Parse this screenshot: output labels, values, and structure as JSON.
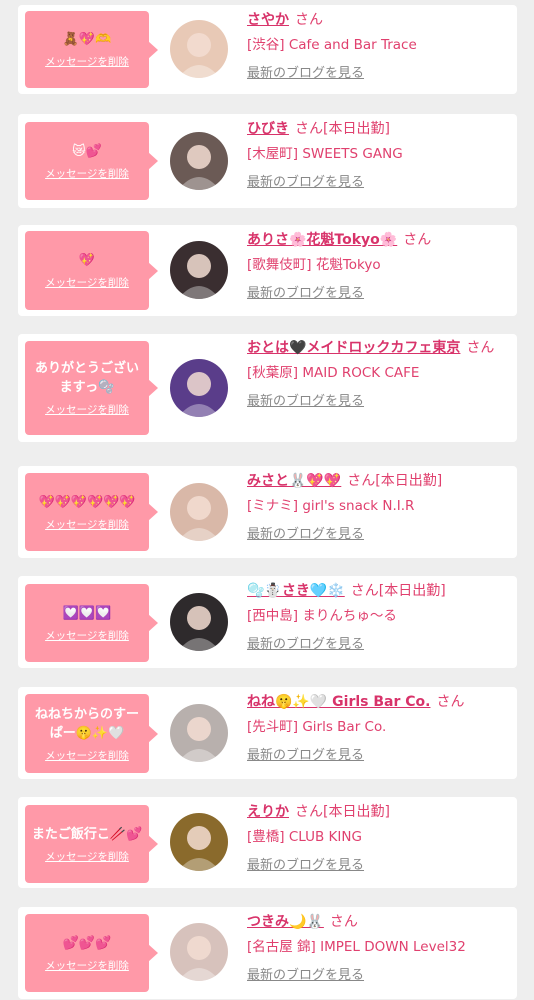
{
  "delete_label": "メッセージを削除",
  "blog_label": "最新のブログを見る",
  "cards": [
    {
      "message": "🧸💖🫶",
      "name": "さやか",
      "suffix": "さん",
      "shop": "[渋谷] Cafe and Bar Trace",
      "avatar_color": "#e8c9b6"
    },
    {
      "message": "😿💕",
      "name": "ひびき",
      "suffix": "さん[本日出勤]",
      "shop": "[木屋町] SWEETS GANG",
      "avatar_color": "#6b5a55"
    },
    {
      "message": "💖",
      "name": "ありさ🌸花魁Tokyo🌸",
      "suffix": "さん",
      "shop": "[歌舞伎町] 花魁Tokyo",
      "avatar_color": "#3a2e30"
    },
    {
      "message": "ありがとうございますっ🫧",
      "name": "おとは🖤メイドロックカフェ東京",
      "suffix": "さん",
      "shop": "[秋葉原] MAID ROCK CAFE",
      "avatar_color": "#5a3d8a"
    },
    {
      "message": "💖💖💖💖💖💖",
      "name": "みさと🐰💖💖",
      "suffix": "さん[本日出勤]",
      "shop": "[ミナミ] girl's snack N.I.R",
      "avatar_color": "#d9b8a8"
    },
    {
      "message": "💟💟💟",
      "name": "🫧☃️さき🩵❄️",
      "suffix": "さん[本日出勤]",
      "shop": "[西中島] まりんちゅ〜る",
      "avatar_color": "#2e2a2c"
    },
    {
      "message": "ねねちからのすーぱー🤫✨🤍",
      "name": "ねね🤫✨🤍 Girls Bar Co.",
      "suffix": "さん",
      "shop": "[先斗町] Girls Bar Co.",
      "avatar_color": "#b8b0ad"
    },
    {
      "message": "またご飯行こ🥢💕",
      "name": "えりか",
      "suffix": "さん[本日出勤]",
      "shop": "[豊橋] CLUB KING",
      "avatar_color": "#8a6a2c"
    },
    {
      "message": "💕💕💕",
      "name": "つきみ🌙🐰",
      "suffix": "さん",
      "shop": "[名古屋 錦] IMPEL DOWN Level32",
      "avatar_color": "#d7c2bc"
    }
  ]
}
